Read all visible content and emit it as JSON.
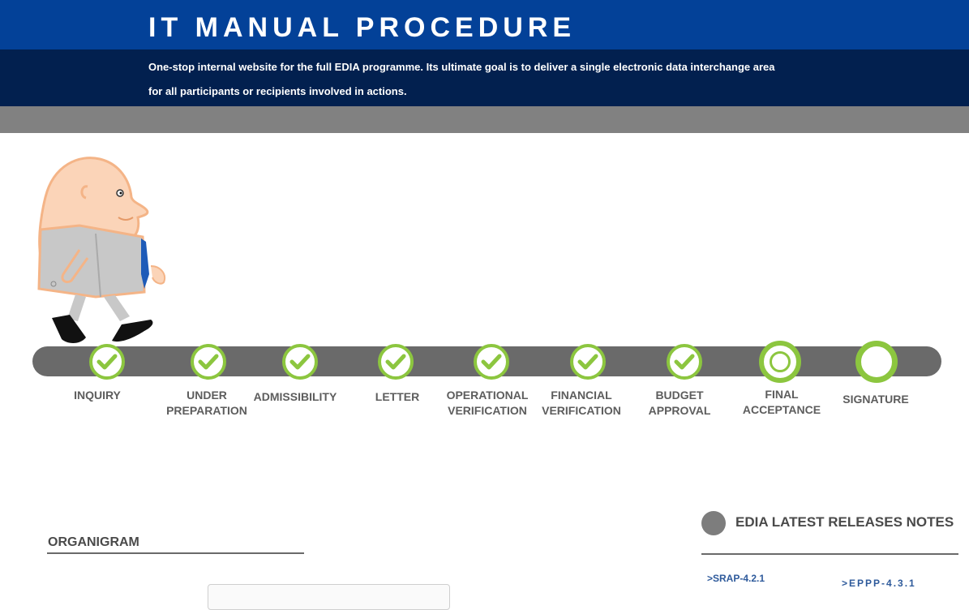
{
  "header": {
    "title": "IT MANUAL PROCEDURE",
    "tagline_line1": "One-stop internal website for the full EDIA programme. Its ultimate goal is to deliver a single electronic data interchange area",
    "tagline_line2": "for all participants or recipients involved in  actions."
  },
  "colors": {
    "header_blue": "#034198",
    "header_navy": "#02204f",
    "band_grey": "#818181",
    "track_grey": "#6a6a6a",
    "step_green": "#8cc63f",
    "link_blue": "#2e5a9b"
  },
  "mascot": {
    "icon": "walking-businessman-mascot"
  },
  "steps": [
    {
      "line1": "INQUIRY",
      "line2": "",
      "status": "done"
    },
    {
      "line1": "UNDER",
      "line2": "PREPARATION",
      "status": "done"
    },
    {
      "line1": "ADMISSIBILITY",
      "line2": "",
      "status": "done"
    },
    {
      "line1": "LETTER",
      "line2": "",
      "status": "done"
    },
    {
      "line1": "OPERATIONAL",
      "line2": "VERIFICATION",
      "status": "done"
    },
    {
      "line1": "FINANCIAL",
      "line2": "VERIFICATION",
      "status": "done"
    },
    {
      "line1": "BUDGET",
      "line2": "APPROVAL",
      "status": "done"
    },
    {
      "line1": "FINAL",
      "line2": "ACCEPTANCE",
      "status": "current"
    },
    {
      "line1": "SIGNATURE",
      "line2": "",
      "status": "pending"
    }
  ],
  "organigram": {
    "heading": "ORGANIGRAM"
  },
  "releases": {
    "heading": "EDIA LATEST RELEASES NOTES",
    "links": [
      ">SRAP-4.2.1",
      ">EPPP-4.3.1"
    ]
  }
}
